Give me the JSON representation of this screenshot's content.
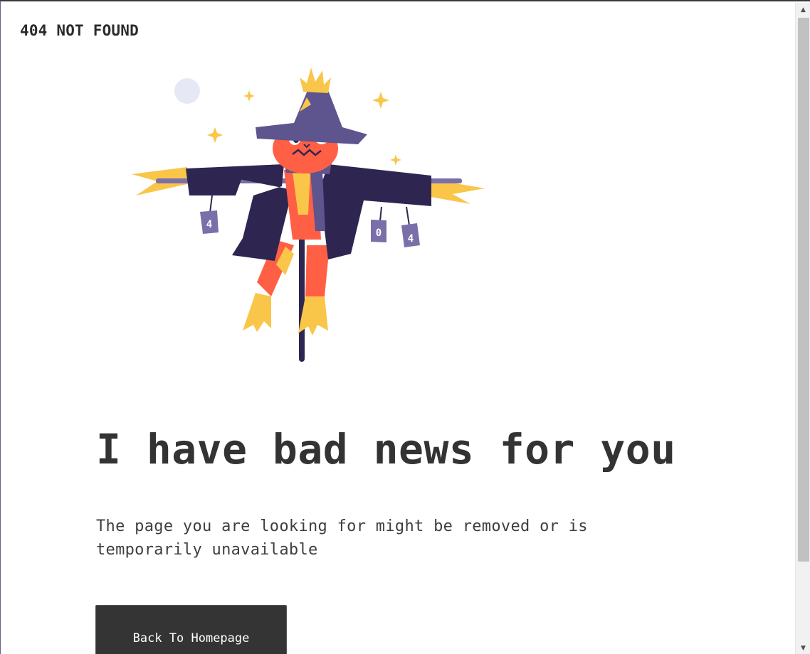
{
  "page": {
    "title": "404 NOT FOUND",
    "headline": "I have bad news for you",
    "message": "The page you are looking for might be removed or is temporarily unavailable",
    "button_label": "Back To Homepage"
  },
  "illustration": {
    "can_labels": [
      "4",
      "0",
      "4"
    ]
  },
  "scrollbar": {
    "up_icon": "▲",
    "down_icon": "▼"
  },
  "colors": {
    "coat": "#2e2650",
    "hat": "#5e548e",
    "face": "#ff5f45",
    "straw": "#f9c64a",
    "text": "#333333",
    "button": "#343434"
  }
}
